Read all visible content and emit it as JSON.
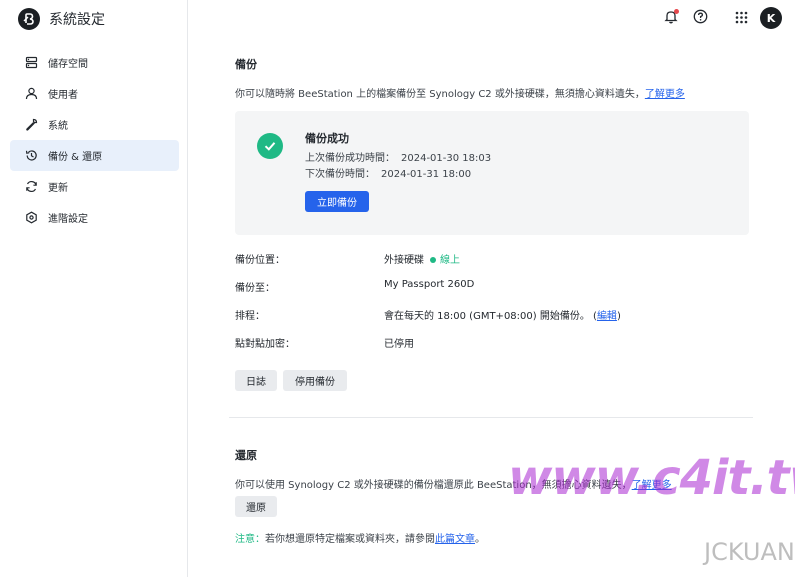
{
  "app": {
    "title": "系統設定"
  },
  "sidebar": {
    "items": [
      {
        "label": "儲存空間",
        "icon": "storage-icon",
        "active": false
      },
      {
        "label": "使用者",
        "icon": "user-icon",
        "active": false
      },
      {
        "label": "系統",
        "icon": "wrench-icon",
        "active": false
      },
      {
        "label": "備份 & 還原",
        "icon": "backup-restore-icon",
        "active": true
      },
      {
        "label": "更新",
        "icon": "refresh-icon",
        "active": false
      },
      {
        "label": "進階設定",
        "icon": "advanced-settings-icon",
        "active": false
      }
    ]
  },
  "topbar": {
    "avatar_initial": "K",
    "has_notification": true
  },
  "backup": {
    "title": "備份",
    "description": "你可以隨時將 BeeStation 上的檔案備份至 Synology C2 或外接硬碟，無須擔心資料遺失，",
    "learn_more": "了解更多",
    "status": {
      "title": "備份成功",
      "last_label": "上次備份成功時間：",
      "last_value": "2024-01-30 18:03",
      "next_label": "下次備份時間：",
      "next_value": "2024-01-31 18:00",
      "backup_now_button": "立即備份"
    },
    "info": {
      "location_label": "備份位置：",
      "location_value": "外接硬碟",
      "location_status": "線上",
      "target_label": "備份至：",
      "target_value": "My Passport 260D",
      "schedule_label": "排程：",
      "schedule_value": "會在每天的 18:00 (GMT+08:00) 開始備份。",
      "schedule_edit_open": "(",
      "schedule_edit": "編輯",
      "schedule_edit_close": ")",
      "encryption_label": "點對點加密：",
      "encryption_value": "已停用"
    },
    "log_button": "日誌",
    "disable_button": "停用備份"
  },
  "restore": {
    "title": "還原",
    "description": "你可以使用 Synology C2 或外接硬碟的備份檔還原此 BeeStation，無須擔心資料遺失，",
    "learn_more": "了解更多",
    "restore_button": "還原",
    "note_prefix": "注意：",
    "note_text": "若你想還原特定檔案或資料夾，請參閱",
    "note_link": "此篇文章",
    "note_suffix": "。"
  },
  "watermark": {
    "text": "www.c4it.tw",
    "sub": "JCKUAN"
  },
  "colors": {
    "accent": "#2563eb",
    "success": "#1fb985",
    "active_bg": "#e8f0fb",
    "notification": "#e5484d"
  }
}
